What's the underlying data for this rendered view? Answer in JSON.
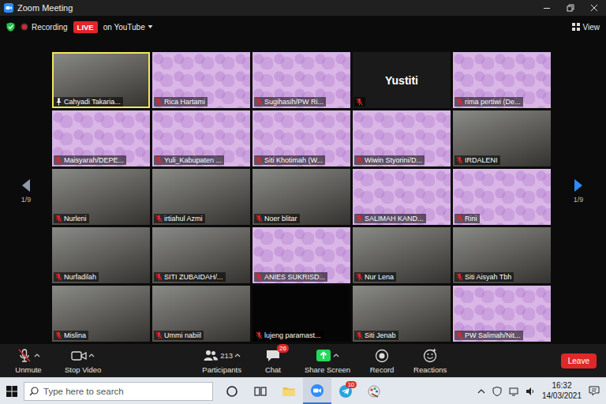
{
  "window": {
    "title": "Zoom Meeting"
  },
  "meeting_bar": {
    "recording": "Recording",
    "live": "LIVE",
    "stream": "on YouTube",
    "view": "View"
  },
  "pager": {
    "left": "1/9",
    "right": "1/9"
  },
  "tiles": [
    {
      "name": "Cahyadi Takaria...",
      "kind": "camera",
      "muted": false,
      "pinned": true,
      "active_speaker": true
    },
    {
      "name": "Rica Hartami",
      "kind": "background",
      "muted": true,
      "pinned": false,
      "active_speaker": false
    },
    {
      "name": "Sugihasih/PW Ri...",
      "kind": "background",
      "muted": true,
      "pinned": false,
      "active_speaker": false
    },
    {
      "name": "Yustiti",
      "kind": "name-only",
      "muted": true,
      "pinned": false,
      "active_speaker": false
    },
    {
      "name": "rima pertiwi (De...",
      "kind": "background",
      "muted": true,
      "pinned": false,
      "active_speaker": false
    },
    {
      "name": "Maisyarah/DEPE...",
      "kind": "background",
      "muted": true,
      "pinned": false,
      "active_speaker": false
    },
    {
      "name": "Yuli_Kabupaten ...",
      "kind": "background",
      "muted": true,
      "pinned": false,
      "active_speaker": false
    },
    {
      "name": "Siti Khotimah (W...",
      "kind": "background",
      "muted": true,
      "pinned": false,
      "active_speaker": false
    },
    {
      "name": "Wiwin Styorini/D...",
      "kind": "background",
      "muted": true,
      "pinned": false,
      "active_speaker": false
    },
    {
      "name": "IRDALENI",
      "kind": "camera",
      "muted": true,
      "pinned": false,
      "active_speaker": false
    },
    {
      "name": "Nurleni",
      "kind": "camera",
      "muted": true,
      "pinned": false,
      "active_speaker": false
    },
    {
      "name": "irtiahul Azmi",
      "kind": "camera",
      "muted": true,
      "pinned": false,
      "active_speaker": false
    },
    {
      "name": "Noer blitar",
      "kind": "camera",
      "muted": true,
      "pinned": false,
      "active_speaker": false
    },
    {
      "name": "SALIMAH KAND...",
      "kind": "background",
      "muted": true,
      "pinned": false,
      "active_speaker": false
    },
    {
      "name": "Rini",
      "kind": "background",
      "muted": true,
      "pinned": false,
      "active_speaker": false
    },
    {
      "name": "Nurfadilah",
      "kind": "camera",
      "muted": true,
      "pinned": false,
      "active_speaker": false
    },
    {
      "name": "SITI ZUBAIDAH/...",
      "kind": "camera",
      "muted": true,
      "pinned": false,
      "active_speaker": false
    },
    {
      "name": "ANIES SUKRISD...",
      "kind": "background",
      "muted": true,
      "pinned": false,
      "active_speaker": false
    },
    {
      "name": "Nur Lena",
      "kind": "camera",
      "muted": true,
      "pinned": false,
      "active_speaker": false
    },
    {
      "name": "Siti Aisyah Tbh",
      "kind": "camera",
      "muted": true,
      "pinned": false,
      "active_speaker": false
    },
    {
      "name": "Mislina",
      "kind": "camera",
      "muted": true,
      "pinned": false,
      "active_speaker": false
    },
    {
      "name": "Ummi nabiil",
      "kind": "camera",
      "muted": true,
      "pinned": false,
      "active_speaker": false
    },
    {
      "name": "lujeng paramast...",
      "kind": "blank",
      "muted": true,
      "pinned": false,
      "active_speaker": false
    },
    {
      "name": "Siti Jenab",
      "kind": "camera",
      "muted": true,
      "pinned": false,
      "active_speaker": false
    },
    {
      "name": "PW Salimah/Nit...",
      "kind": "background",
      "muted": true,
      "pinned": false,
      "active_speaker": false
    }
  ],
  "toolbar": {
    "left": [
      {
        "label": "Unmute",
        "kind": "mic-off",
        "has_menu": true
      },
      {
        "label": "Stop Video",
        "kind": "video",
        "has_menu": true
      }
    ],
    "center": [
      {
        "label": "Participants",
        "kind": "participants",
        "has_menu": true,
        "count": "213"
      },
      {
        "label": "Chat",
        "kind": "chat",
        "has_menu": false,
        "badge": "26"
      },
      {
        "label": "Share Screen",
        "kind": "share",
        "has_menu": true
      },
      {
        "label": "Record",
        "kind": "record",
        "has_menu": false
      },
      {
        "label": "Reactions",
        "kind": "reactions",
        "has_menu": false
      }
    ],
    "leave": "Leave"
  },
  "taskbar": {
    "search_placeholder": "Type here to search",
    "apps": [
      {
        "kind": "cortana",
        "active": false
      },
      {
        "kind": "task-view",
        "active": false
      },
      {
        "kind": "explorer",
        "active": false
      },
      {
        "kind": "zoom",
        "active": true
      },
      {
        "kind": "telegram",
        "active": false,
        "badge": "10"
      },
      {
        "kind": "paint",
        "active": false
      }
    ],
    "time": "16:32",
    "date": "14/03/2021"
  }
}
